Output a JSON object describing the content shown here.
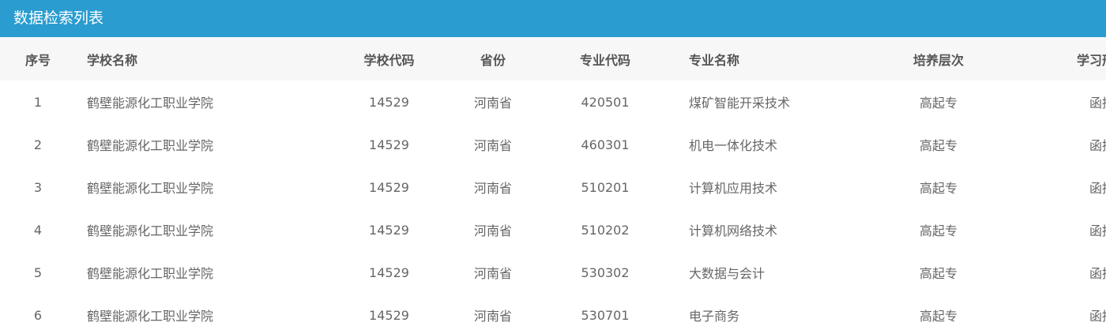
{
  "panel": {
    "title": "数据检索列表"
  },
  "table": {
    "headers": {
      "seq": "序号",
      "school_name": "学校名称",
      "school_code": "学校代码",
      "province": "省份",
      "major_code": "专业代码",
      "major_name": "专业名称",
      "level": "培养层次",
      "study_mode": "学习形式"
    },
    "rows": [
      {
        "seq": "1",
        "school_name": "鹤壁能源化工职业学院",
        "school_code": "14529",
        "province": "河南省",
        "major_code": "420501",
        "major_name": "煤矿智能开采技术",
        "level": "高起专",
        "study_mode": "函授"
      },
      {
        "seq": "2",
        "school_name": "鹤壁能源化工职业学院",
        "school_code": "14529",
        "province": "河南省",
        "major_code": "460301",
        "major_name": "机电一体化技术",
        "level": "高起专",
        "study_mode": "函授"
      },
      {
        "seq": "3",
        "school_name": "鹤壁能源化工职业学院",
        "school_code": "14529",
        "province": "河南省",
        "major_code": "510201",
        "major_name": "计算机应用技术",
        "level": "高起专",
        "study_mode": "函授"
      },
      {
        "seq": "4",
        "school_name": "鹤壁能源化工职业学院",
        "school_code": "14529",
        "province": "河南省",
        "major_code": "510202",
        "major_name": "计算机网络技术",
        "level": "高起专",
        "study_mode": "函授"
      },
      {
        "seq": "5",
        "school_name": "鹤壁能源化工职业学院",
        "school_code": "14529",
        "province": "河南省",
        "major_code": "530302",
        "major_name": "大数据与会计",
        "level": "高起专",
        "study_mode": "函授"
      },
      {
        "seq": "6",
        "school_name": "鹤壁能源化工职业学院",
        "school_code": "14529",
        "province": "河南省",
        "major_code": "530701",
        "major_name": "电子商务",
        "level": "高起专",
        "study_mode": "函授"
      }
    ]
  },
  "colors": {
    "header_bar": "#2a9cd0",
    "table_head_bg": "#f7f7f7"
  }
}
